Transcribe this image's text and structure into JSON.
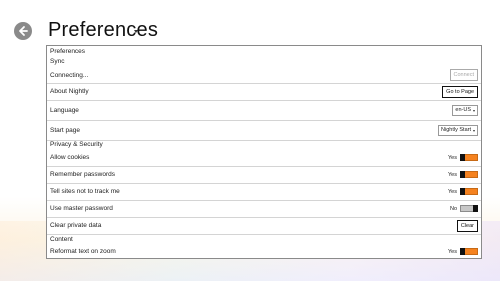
{
  "page": {
    "title": "Preferences"
  },
  "colors": {
    "toggle_on": "#f5821f",
    "toggle_off": "#c8c8c8",
    "thumb": "#111111"
  },
  "icons": {
    "back": "back-arrow-icon",
    "title_menu": "chevron-down-icon"
  },
  "sections": {
    "preferences": "Preferences",
    "sync": "Sync",
    "privacy": "Privacy & Security",
    "content": "Content"
  },
  "rows": {
    "connecting": {
      "label": "Connecting...",
      "button": "Connect"
    },
    "about": {
      "label": "About Nightly",
      "button": "Go to Page"
    },
    "language": {
      "label": "Language",
      "value": "en-US"
    },
    "start_page": {
      "label": "Start page",
      "value": "Nightly Start"
    },
    "cookies": {
      "label": "Allow cookies",
      "state": "Yes"
    },
    "passwords": {
      "label": "Remember passwords",
      "state": "Yes"
    },
    "do_not_track": {
      "label": "Tell sites not to track me",
      "state": "Yes"
    },
    "master_password": {
      "label": "Use master password",
      "state": "No"
    },
    "clear_data": {
      "label": "Clear private data",
      "button": "Clear"
    },
    "reformat": {
      "label": "Reformat text on zoom",
      "state": "Yes"
    }
  }
}
